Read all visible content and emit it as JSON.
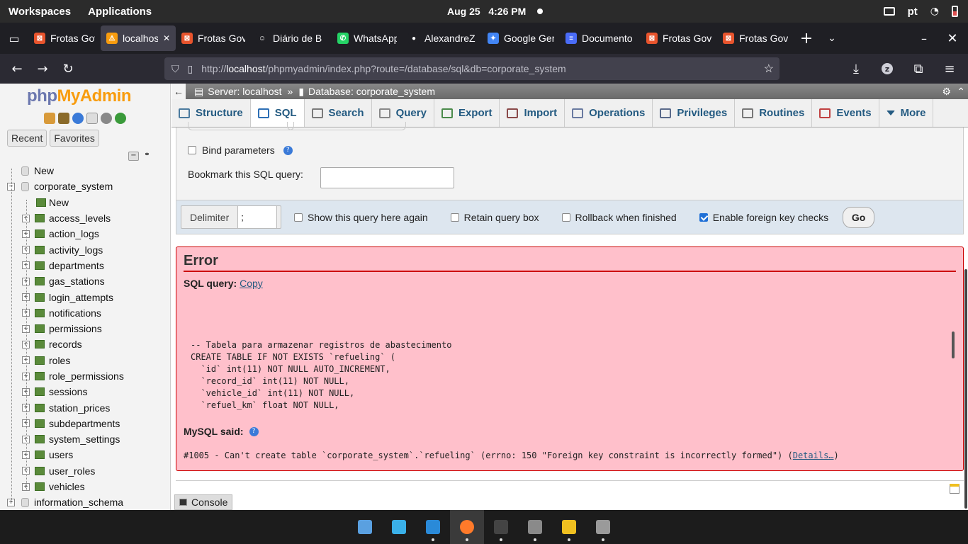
{
  "system": {
    "workspaces": "Workspaces",
    "applications": "Applications",
    "date": "Aug 25",
    "time": "4:26 PM",
    "lang": "pt"
  },
  "tabs": [
    {
      "label": "Frotas Gov",
      "color": "#e8542d",
      "glyph": "⊠"
    },
    {
      "label": "localhost",
      "color": "#f89c0e",
      "glyph": "⚠"
    },
    {
      "label": "Frotas Gov",
      "color": "#e8542d",
      "glyph": "⊠"
    },
    {
      "label": "Diário de B",
      "color": "#1f1f24",
      "glyph": "☺"
    },
    {
      "label": "WhatsApp",
      "color": "#25d366",
      "glyph": "✆"
    },
    {
      "label": "AlexandreZ",
      "color": "#1f1f24",
      "glyph": "●"
    },
    {
      "label": "Google Gem",
      "color": "#4285f4",
      "glyph": "✦"
    },
    {
      "label": "Documento",
      "color": "#4a6cf7",
      "glyph": "≡"
    },
    {
      "label": "Frotas Gov",
      "color": "#e8542d",
      "glyph": "⊠"
    },
    {
      "label": "Frotas Gov",
      "color": "#e8542d",
      "glyph": "⊠"
    }
  ],
  "url": {
    "scheme": "http://",
    "host": "localhost",
    "path": "/phpmyadmin/index.php?route=/database/sql&db=corporate_system"
  },
  "pma": {
    "logo_php": "php",
    "logo_myadmin": "MyAdmin",
    "recent": "Recent",
    "favorites": "Favorites",
    "breadcrumb_server": "Server: localhost",
    "breadcrumb_db": "Database: corporate_system",
    "menu": [
      {
        "label": "Structure",
        "color": "#4b7a9e"
      },
      {
        "label": "SQL",
        "color": "#2d6fb5"
      },
      {
        "label": "Search",
        "color": "#7a7a7a"
      },
      {
        "label": "Query",
        "color": "#888888"
      },
      {
        "label": "Export",
        "color": "#4a8a4a"
      },
      {
        "label": "Import",
        "color": "#8a4a4a"
      },
      {
        "label": "Operations",
        "color": "#6a7aa0"
      },
      {
        "label": "Privileges",
        "color": "#5a6a8a"
      },
      {
        "label": "Routines",
        "color": "#777777"
      },
      {
        "label": "Events",
        "color": "#c04040"
      },
      {
        "label": "More",
        "color": "#235a81"
      }
    ],
    "tree_new": "New",
    "tree_db": "corporate_system",
    "tree_db_new": "New",
    "tables": [
      "access_levels",
      "action_logs",
      "activity_logs",
      "departments",
      "gas_stations",
      "login_attempts",
      "notifications",
      "permissions",
      "records",
      "roles",
      "role_permissions",
      "sessions",
      "station_prices",
      "subdepartments",
      "system_settings",
      "users",
      "user_roles",
      "vehicles"
    ],
    "tree_info": "information_schema",
    "bind_params": "Bind parameters",
    "bookmark_label": "Bookmark this SQL query:",
    "bookmark_value": "",
    "delimiter_label": "Delimiter",
    "delimiter_value": ";",
    "show_query": "Show this query here again",
    "retain_box": "Retain query box",
    "rollback": "Rollback when finished",
    "fk_checks": "Enable foreign key checks",
    "go": "Go",
    "error_title": "Error",
    "sql_query_label": "SQL query:",
    "copy": "Copy",
    "sql_lines": [
      "-- Tabela para armazenar registros de abastecimento",
      "CREATE TABLE IF NOT EXISTS `refueling` (",
      "  `id` int(11) NOT NULL AUTO_INCREMENT,",
      "  `record_id` int(11) NOT NULL,",
      "  `vehicle_id` int(11) NOT NULL,",
      "  `refuel_km` float NOT NULL,"
    ],
    "mysql_said": "MySQL said:",
    "error_msg": "#1005 - Can't create table `corporate_system`.`refueling` (errno: 150 \"Foreign key constraint is incorrectly formed\") (",
    "details": "Details…",
    "error_close": ")",
    "console": "Console"
  },
  "taskbar": [
    {
      "name": "screenshot-app",
      "color": "#5aa0e0",
      "active": false,
      "dot": false
    },
    {
      "name": "apps-grid",
      "color": "#3ab0e8",
      "active": false,
      "dot": false
    },
    {
      "name": "vscode",
      "color": "#2a8ad8",
      "active": false,
      "dot": true
    },
    {
      "name": "firefox",
      "color": "#ff7a2a",
      "active": true,
      "dot": true
    },
    {
      "name": "terminal",
      "color": "#444444",
      "active": false,
      "dot": true
    },
    {
      "name": "files",
      "color": "#8a8a8a",
      "active": false,
      "dot": true
    },
    {
      "name": "notes",
      "color": "#f0c020",
      "active": false,
      "dot": true
    },
    {
      "name": "settings",
      "color": "#9a9a9a",
      "active": false,
      "dot": true
    }
  ]
}
